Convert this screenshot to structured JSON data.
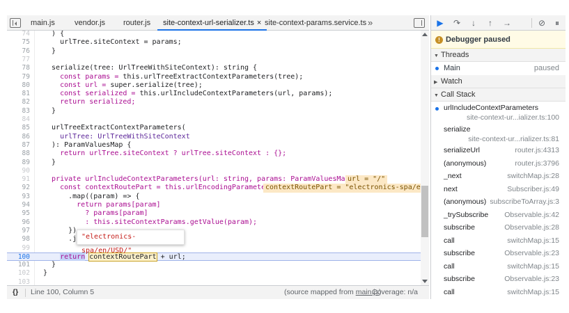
{
  "tabs": [
    {
      "label": "main.js"
    },
    {
      "label": "vendor.js"
    },
    {
      "label": "router.js"
    },
    {
      "label": "site-context-url-serializer.ts",
      "active": true,
      "close": "×"
    },
    {
      "label": "site-context-params.service.ts"
    }
  ],
  "tab_overflow": "»",
  "code_lines": [
    {
      "n": "74",
      "dim": true
    },
    {
      "n": "75"
    },
    {
      "n": "76"
    },
    {
      "n": "77",
      "dim": true
    },
    {
      "n": "78"
    },
    {
      "n": "79"
    },
    {
      "n": "80"
    },
    {
      "n": "81"
    },
    {
      "n": "82"
    },
    {
      "n": "83"
    },
    {
      "n": "84",
      "dim": true
    },
    {
      "n": "85"
    },
    {
      "n": "86"
    },
    {
      "n": "87"
    },
    {
      "n": "88"
    },
    {
      "n": "89"
    },
    {
      "n": "90",
      "dim": true
    },
    {
      "n": "91",
      "dim": true
    },
    {
      "n": "92"
    },
    {
      "n": "93"
    },
    {
      "n": "94"
    },
    {
      "n": "95"
    },
    {
      "n": "96"
    },
    {
      "n": "97"
    },
    {
      "n": "98"
    },
    {
      "n": "99",
      "dim": true
    },
    {
      "n": "100"
    },
    {
      "n": "101"
    },
    {
      "n": "102",
      "dim": true
    },
    {
      "n": "103",
      "dim": true
    }
  ],
  "code_text": {
    "l74": "  ) {",
    "l75": "    urlTree.siteContext = params;",
    "l76": "  }",
    "l78": "  serialize(tree: UrlTreeWithSiteContext): string {",
    "l79a": "    const params = ",
    "l79b": "this.urlTreeExtractContextParameters(tree);",
    "l80a": "    const url = ",
    "l80b": "super.serialize(tree);",
    "l81a": "    const serialized = ",
    "l81b": "this.urlIncludeContextParameters(url, params);",
    "l82": "    return serialized;",
    "l83": "  }",
    "l85": "  urlTreeExtractContextParameters(",
    "l86": "    urlTree: UrlTreeWithSiteContext",
    "l87": "  ): ParamValuesMap {",
    "l88": "    return urlTree.siteContext ? urlTree.siteContext : {};",
    "l89": "  }",
    "l91": "  private urlIncludeContextParameters(url: string, params: ParamValuesMap) {",
    "l91val": "url = \"/\"",
    "l92": "    const contextRoutePart = this.urlEncodingParameters",
    "l92val": "contextRoutePart = \"electronics-spa/en/USD",
    "l93": "      .map((param) => {",
    "l94": "        return params[param]",
    "l95": "          ? params[param]",
    "l96": "          : this.siteContextParams.getValue(param);",
    "l97": "      })",
    "l98": "      .jo",
    "l100a": "    ",
    "l100kw": "return",
    "l100var": "contextRoutePart",
    "l100b": " + url;",
    "l101": "  }",
    "l102": "}"
  },
  "tooltip": "\"electronics-spa/en/USD/\"",
  "status": {
    "braces": "{}",
    "position": "Line 100, Column 5",
    "source_map_prefix": "(source mapped from ",
    "source_map_file": "main.js",
    "source_map_suffix": ")",
    "coverage": "Coverage: n/a"
  },
  "debugger": {
    "paused_label": "Debugger paused",
    "paused_icon": "!",
    "threads_label": "Threads",
    "thread_name": "Main",
    "thread_status": "paused",
    "watch_label": "Watch",
    "callstack_label": "Call Stack",
    "toolbar": {
      "resume": "▶",
      "step_over": "↷",
      "step_into": "↓",
      "step_out": "↑",
      "step": "→",
      "deactivate": "⊘",
      "pause_exceptions": "⏸"
    },
    "frames": [
      {
        "name": "urlIncludeContextParameters",
        "loc": "site-context-ur...ializer.ts:100"
      },
      {
        "name": "serialize",
        "loc": "site-context-ur...rializer.ts:81"
      },
      {
        "name": "serializeUrl",
        "loc": "router.js:4313"
      },
      {
        "name": "(anonymous)",
        "loc": "router.js:3796"
      },
      {
        "name": "_next",
        "loc": "switchMap.js:28"
      },
      {
        "name": "next",
        "loc": "Subscriber.js:49"
      },
      {
        "name": "(anonymous)",
        "loc": "subscribeToArray.js:3"
      },
      {
        "name": "_trySubscribe",
        "loc": "Observable.js:42"
      },
      {
        "name": "subscribe",
        "loc": "Observable.js:28"
      },
      {
        "name": "call",
        "loc": "switchMap.js:15"
      },
      {
        "name": "subscribe",
        "loc": "Observable.js:23"
      },
      {
        "name": "call",
        "loc": "switchMap.js:15"
      },
      {
        "name": "subscribe",
        "loc": "Observable.js:23"
      },
      {
        "name": "call",
        "loc": "switchMap.js:15"
      }
    ]
  },
  "colors": {
    "accent": "#1a73e8",
    "paused_banner": "#fffbe6",
    "exec_line": "#e9eefc",
    "inline_value": "#fce8c5"
  }
}
